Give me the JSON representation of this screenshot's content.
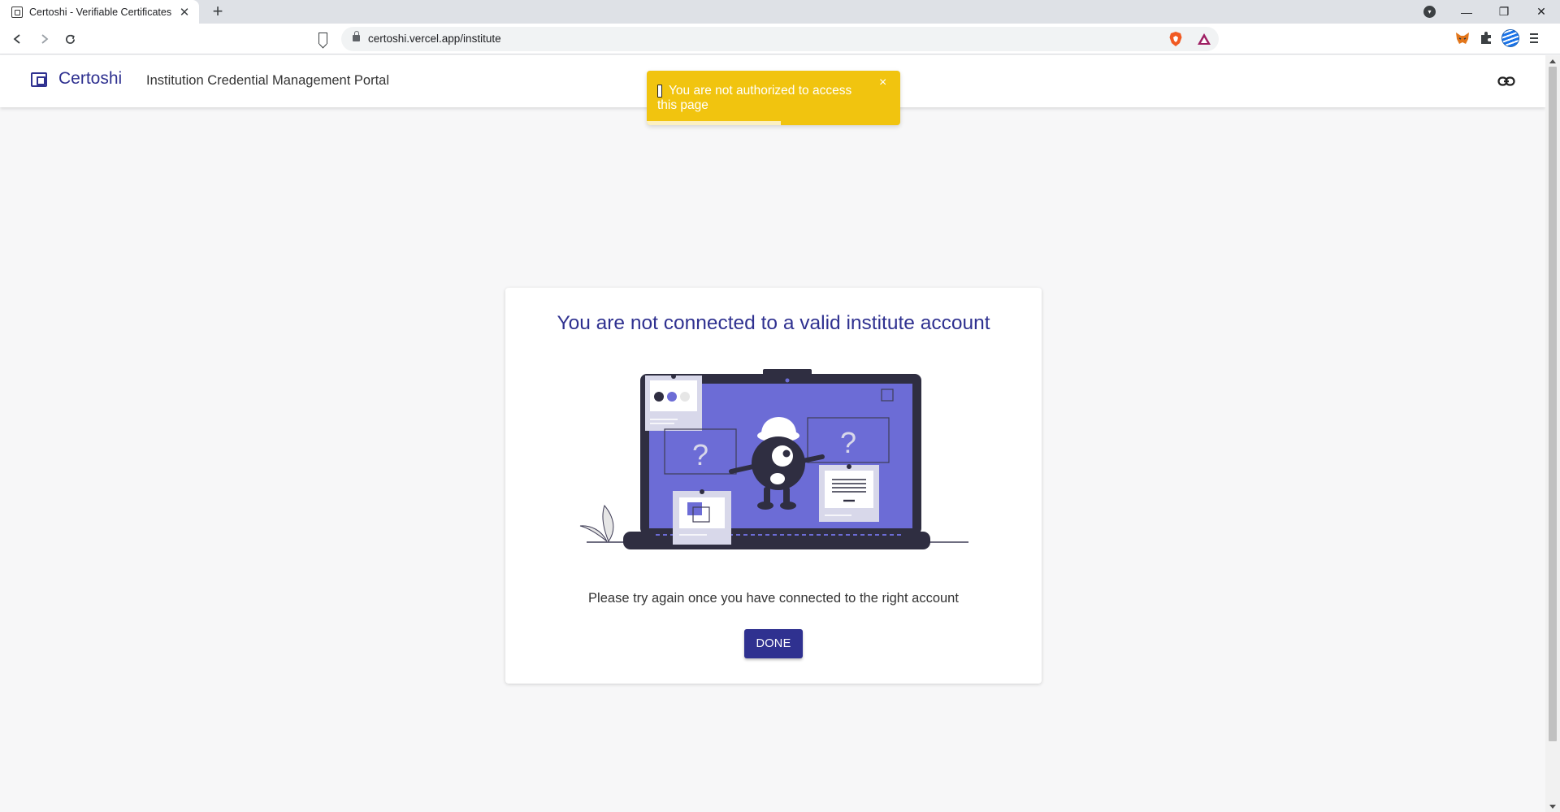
{
  "browser": {
    "tab_title": "Certoshi - Verifiable Certificates",
    "new_tab_label": "+",
    "url": "certoshi.vercel.app/institute"
  },
  "header": {
    "brand": "Certoshi",
    "portal_title": "Institution Credential Management Portal"
  },
  "toast": {
    "message": "You are not authorized to access this page",
    "close_label": "×",
    "progress": 0.53
  },
  "card": {
    "title": "You are not connected to a valid institute account",
    "message": "Please try again once you have connected to the right account",
    "button_label": "DONE",
    "illustration_marks": [
      "?",
      "?"
    ]
  },
  "icons": {
    "logo": "certificate-icon",
    "link": "link-icon",
    "toast": "warning-icon"
  },
  "colors": {
    "brand": "#2f3190",
    "toast": "#f1c40f",
    "illustration_accent": "#6c6cd6",
    "illustration_dark": "#2f2e41"
  }
}
